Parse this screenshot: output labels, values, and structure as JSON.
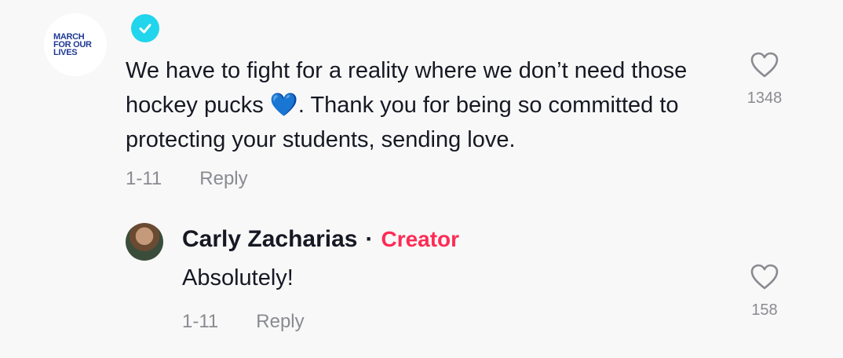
{
  "comment": {
    "logo_lines": [
      "MARCH",
      "FOR OUR",
      "LIVES"
    ],
    "text_before_emoji": "We have to fight for a reality where we don’t need those hockey pucks ",
    "emoji": "💙",
    "text_after_emoji": ". Thank you for being so committed to protecting your students, sending love.",
    "date": "1-11",
    "reply_label": "Reply",
    "like_count": "1348"
  },
  "reply": {
    "author": "Carly Zacharias",
    "separator": "·",
    "badge": "Creator",
    "text": "Absolutely!",
    "date": "1-11",
    "reply_label": "Reply",
    "like_count": "158"
  },
  "colors": {
    "background": "#f8f8f8",
    "text": "#161823",
    "meta": "#8a8b91",
    "creator": "#fe2c55",
    "verified": "#20d5ec"
  }
}
